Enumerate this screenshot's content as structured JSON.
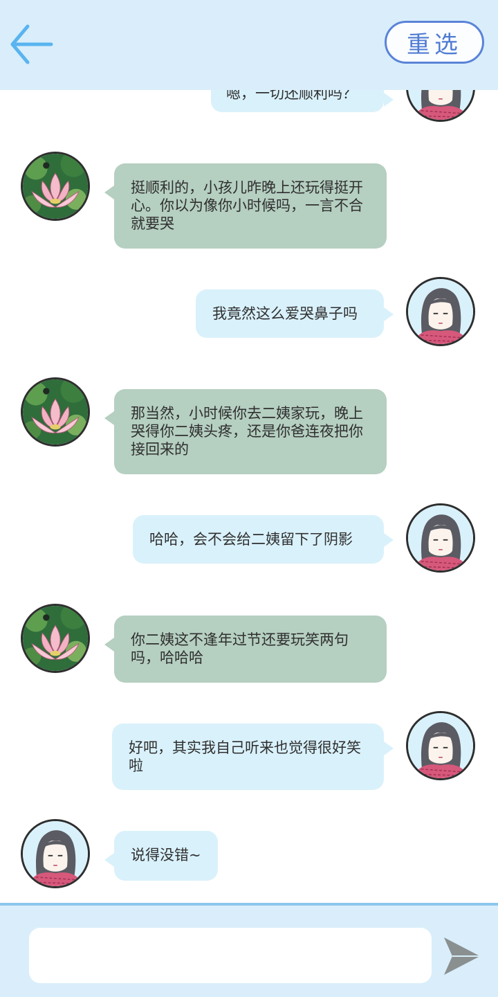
{
  "header": {
    "back_icon": "arrow-left-icon",
    "reselect_label": "重选"
  },
  "messages": [
    {
      "side": "right",
      "avatar": "girl-avatar",
      "text": "嗯，一切还顺利吗？"
    },
    {
      "side": "left",
      "avatar": "lotus-avatar",
      "text": "挺顺利的，小孩儿昨晚上还玩得挺开心。你以为像你小时候吗，一言不合就要哭"
    },
    {
      "side": "right",
      "avatar": "girl-avatar",
      "text": "我竟然这么爱哭鼻子吗"
    },
    {
      "side": "left",
      "avatar": "lotus-avatar",
      "text": "那当然，小时候你去二姨家玩，晚上哭得你二姨头疼，还是你爸连夜把你接回来的"
    },
    {
      "side": "right",
      "avatar": "girl-avatar",
      "text": "哈哈，会不会给二姨留下了阴影"
    },
    {
      "side": "left",
      "avatar": "lotus-avatar",
      "text": "你二姨这不逢年过节还要玩笑两句吗，哈哈哈"
    },
    {
      "side": "right",
      "avatar": "girl-avatar",
      "text": "好吧，其实我自己听来也觉得很好笑啦"
    },
    {
      "side": "left",
      "avatar": "girl-avatar",
      "text": "说得没错~"
    }
  ],
  "composer": {
    "input_value": "",
    "send_icon": "send-arrow-icon"
  },
  "colors": {
    "header_bg": "#d9eefa",
    "accent": "#5a83d8",
    "left_bubble": "#b5cfc1",
    "right_bubble": "#d9f1fb"
  }
}
